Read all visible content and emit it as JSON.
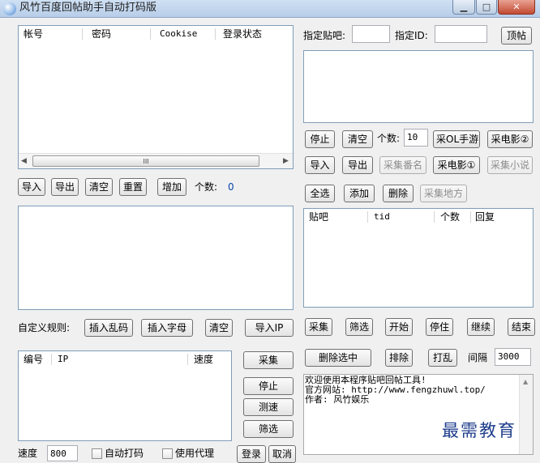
{
  "window": {
    "title": "风竹百度回帖助手自动打码版",
    "min_glyph": "▁",
    "max_glyph": "□",
    "close_glyph": "✕"
  },
  "accounts": {
    "columns": [
      "帐号",
      "密码",
      "Cookise",
      "登录状态"
    ],
    "scroll_glyph": "III",
    "import_label": "导入",
    "export_label": "导出",
    "clear_label": "清空",
    "reset_label": "重置",
    "add_label": "增加",
    "count_label": "个数:",
    "count_value": "0"
  },
  "rules": {
    "label": "自定义规则:",
    "insert_garble": "插入乱码",
    "insert_letters": "插入字母",
    "clear": "清空",
    "import_ip": "导入IP"
  },
  "proxy": {
    "columns": [
      "编号",
      "IP",
      "速度"
    ],
    "collect": "采集",
    "stop": "停止",
    "test": "测速",
    "filter": "筛选",
    "speed_label": "速度",
    "speed_value": "800",
    "auto_captcha": "自动打码",
    "use_proxy": "使用代理",
    "login": "登录",
    "cancel": "取消"
  },
  "target": {
    "bar_label": "指定贴吧:",
    "bar_value": "",
    "id_label": "指定ID:",
    "id_value": "",
    "top_post": "顶帖"
  },
  "controls": {
    "stop": "停止",
    "clear": "清空",
    "count_label": "个数:",
    "count_value": "10",
    "collect_ol": "采OL手游",
    "collect_movie2": "采电影②",
    "import": "导入",
    "export": "导出",
    "collect_anime": "采集番名",
    "collect_movie1": "采电影①",
    "collect_novel": "采集小说",
    "select_all": "全选",
    "add": "添加",
    "delete": "删除",
    "collect_place": "采集地方"
  },
  "posts": {
    "columns": [
      "贴吧",
      "tid",
      "个数",
      "回复"
    ]
  },
  "actions": {
    "collect": "采集",
    "filter": "筛选",
    "start": "开始",
    "pause": "停住",
    "resume": "继续",
    "end": "结束",
    "delete_selected": "删除选中",
    "exclude": "排除",
    "shuffle": "打乱",
    "interval_label": "间隔",
    "interval_value": "3000"
  },
  "log": {
    "lines": [
      "欢迎使用本程序贴吧回帖工具!",
      "官方网站: http://www.fengzhuwl.top/",
      "作者: 风竹娱乐"
    ],
    "scroll_glyph": "▲"
  },
  "watermark": "最需教育"
}
